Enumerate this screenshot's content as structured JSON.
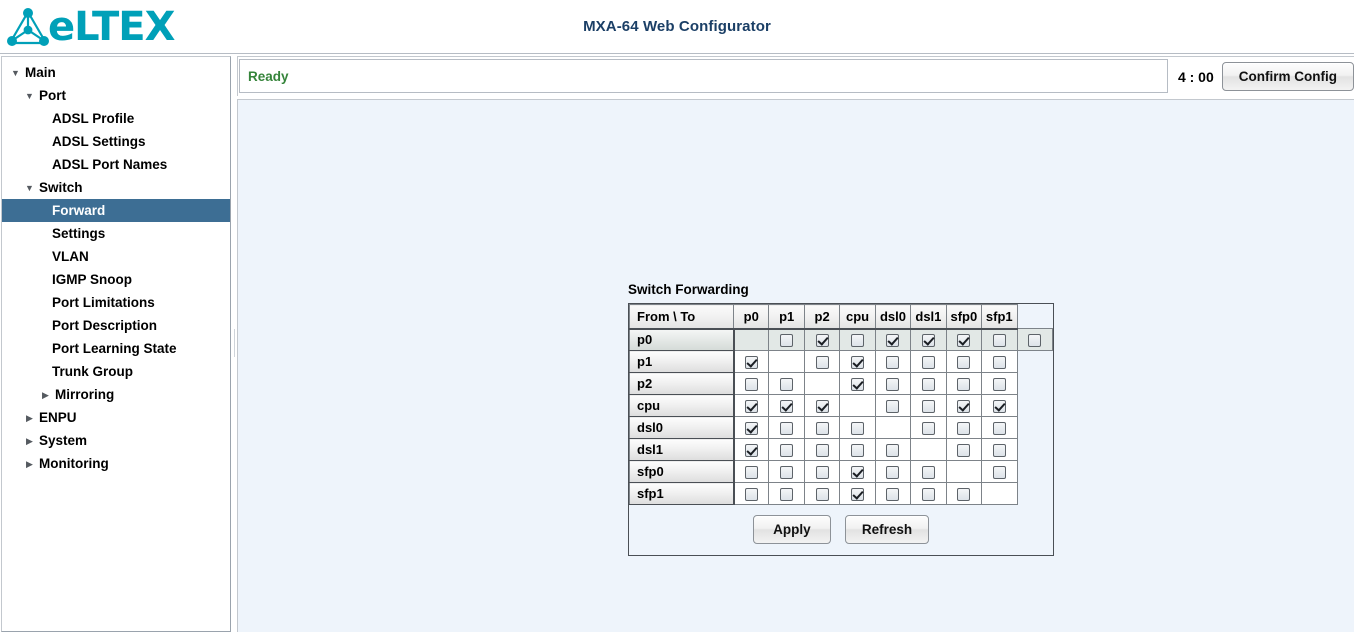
{
  "header": {
    "logo_text": "eLTEX",
    "logo_icon": "eltex-triangle-logo-icon",
    "title": "MXA-64 Web Configurator"
  },
  "sidebar": {
    "items": [
      {
        "label": "Main",
        "level": 0,
        "twisty": "down",
        "selected": false
      },
      {
        "label": "Port",
        "level": 1,
        "twisty": "down",
        "selected": false
      },
      {
        "label": "ADSL Profile",
        "level": 2,
        "twisty": "none",
        "selected": false
      },
      {
        "label": "ADSL Settings",
        "level": 2,
        "twisty": "none",
        "selected": false
      },
      {
        "label": "ADSL Port Names",
        "level": 2,
        "twisty": "none",
        "selected": false
      },
      {
        "label": "Switch",
        "level": 1,
        "twisty": "down",
        "selected": false
      },
      {
        "label": "Forward",
        "level": 2,
        "twisty": "none",
        "selected": true
      },
      {
        "label": "Settings",
        "level": 2,
        "twisty": "none",
        "selected": false
      },
      {
        "label": "VLAN",
        "level": 2,
        "twisty": "none",
        "selected": false
      },
      {
        "label": "IGMP Snoop",
        "level": 2,
        "twisty": "none",
        "selected": false
      },
      {
        "label": "Port Limitations",
        "level": 2,
        "twisty": "none",
        "selected": false
      },
      {
        "label": "Port Description",
        "level": 2,
        "twisty": "none",
        "selected": false
      },
      {
        "label": "Port Learning State",
        "level": 2,
        "twisty": "none",
        "selected": false
      },
      {
        "label": "Trunk Group",
        "level": 2,
        "twisty": "none",
        "selected": false
      },
      {
        "label": "Mirroring",
        "level": 2,
        "twisty": "right",
        "selected": false
      },
      {
        "label": "ENPU",
        "level": 1,
        "twisty": "right",
        "selected": false
      },
      {
        "label": "System",
        "level": 1,
        "twisty": "right",
        "selected": false
      },
      {
        "label": "Monitoring",
        "level": 1,
        "twisty": "right",
        "selected": false
      }
    ]
  },
  "statusbar": {
    "status_text": "Ready",
    "timer": "4 : 00",
    "confirm_label": "Confirm Config"
  },
  "forwarding": {
    "panel_title": "Switch Forwarding",
    "corner_label": "From \\ To",
    "columns": [
      "p0",
      "p1",
      "p2",
      "cpu",
      "dsl0",
      "dsl1",
      "sfp0",
      "sfp1"
    ],
    "rows": [
      {
        "name": "p0",
        "highlight": true,
        "cells": [
          "diag",
          false,
          true,
          false,
          true,
          true,
          true,
          false,
          false
        ]
      },
      {
        "name": "p1",
        "highlight": false,
        "cells": [
          true,
          "diag",
          false,
          true,
          false,
          false,
          false,
          false
        ]
      },
      {
        "name": "p2",
        "highlight": false,
        "cells": [
          false,
          false,
          "diag",
          true,
          false,
          false,
          false,
          false
        ]
      },
      {
        "name": "cpu",
        "highlight": false,
        "cells": [
          true,
          true,
          true,
          "diag",
          false,
          false,
          true,
          true
        ]
      },
      {
        "name": "dsl0",
        "highlight": false,
        "cells": [
          true,
          false,
          false,
          false,
          "diag",
          false,
          false,
          false
        ]
      },
      {
        "name": "dsl1",
        "highlight": false,
        "cells": [
          true,
          false,
          false,
          false,
          false,
          "diag",
          false,
          false
        ]
      },
      {
        "name": "sfp0",
        "highlight": false,
        "cells": [
          false,
          false,
          false,
          true,
          false,
          false,
          "diag",
          false
        ]
      },
      {
        "name": "sfp1",
        "highlight": false,
        "cells": [
          false,
          false,
          false,
          true,
          false,
          false,
          false,
          "diag"
        ]
      }
    ],
    "apply_label": "Apply",
    "refresh_label": "Refresh"
  },
  "colors": {
    "brand": "#00a0b8",
    "title": "#1b3f66",
    "selection": "#3d6e94",
    "status_ok": "#35843a",
    "content_bg": "#eef4fb"
  }
}
